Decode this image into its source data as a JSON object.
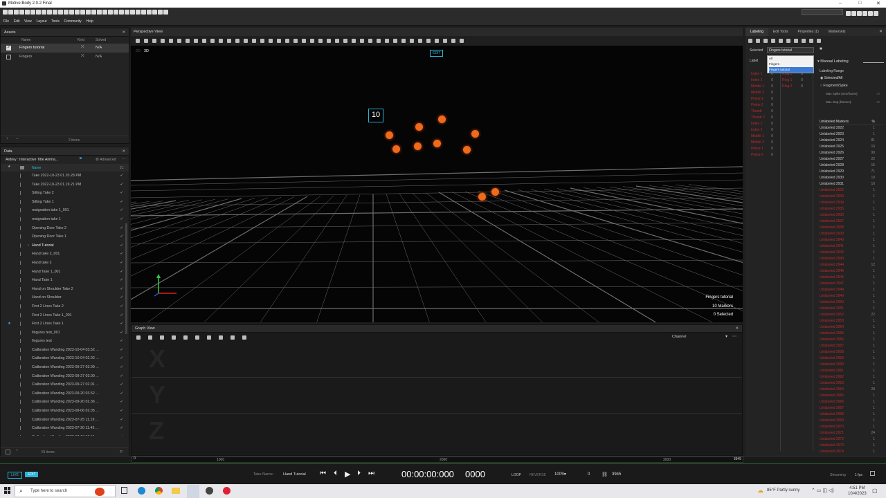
{
  "window": {
    "title": "Motive:Body 2.0.2 Final",
    "controls": [
      "–",
      "□",
      "✕"
    ]
  },
  "menu": [
    "File",
    "Edit",
    "View",
    "Layout",
    "Tools",
    "Community",
    "Help"
  ],
  "assets": {
    "title": "Assets",
    "cols": {
      "name": "Name",
      "kind": "Kind",
      "solved": "Solved"
    },
    "rows": [
      {
        "name": "Fingers tutorial",
        "solved": "N/A",
        "checked": true
      },
      {
        "name": "Fingers",
        "solved": "N/A",
        "checked": false
      }
    ],
    "footer": "2 items"
  },
  "data": {
    "title": "Data",
    "project": "Ardrey : Interactive Title Anima...",
    "advanced": "Advanced",
    "col_name": "Name",
    "count_col": "21",
    "takes": [
      "Take 2022-10-23 01.20.28 PM",
      "Take 2022-10-23 01.19.21 PM",
      "Sitting Take 2",
      "Sitting Take 1",
      "resignation take 1_001",
      "resignation take 1",
      "Opening Door Take 2",
      "Opening Door Take 1",
      "Hand Tutorial",
      "Hand take 2_001",
      "Hand take 2",
      "Hand Take 1_001",
      "Hand Take 1",
      "Hand on Shoulder Take 2",
      "Hand on Shoulder",
      "First 2 Lines Take 2",
      "First 2 Lines Take 1_001",
      "First 2 Lines Take 1",
      "fingures test_001",
      "fingures test",
      "Calibration Wanding 2023-10-04 03.52 ...",
      "Calibration Wanding 2023-10-04 02.02 ...",
      "Calibration Wanding 2023-09-27 03.09 ...",
      "Calibration Wanding 2023-09-27 03.00 ...",
      "Calibration Wanding 2023-09-27 02.01 ...",
      "Calibration Wanding 2023-09-20 03.52 ...",
      "Calibration Wanding 2023-09-20 02.36 ...",
      "Calibration Wanding 2023-09-06 02.05 ...",
      "Calibration Wanding 2023-07-25 11.19 ...",
      "Calibration Wanding 2023-07-20 11.45 ...",
      "Calibration Wanding 2023-07-13 08.51 ..."
    ],
    "footer": "81 items"
  },
  "viewport": {
    "title": "Perspective View",
    "mode": "3D",
    "edit_badge": "EDIT",
    "asset_tag": "10",
    "info": {
      "asset": "Fingers tutorial",
      "markers": "10 Markers",
      "selected": "0 Selected"
    }
  },
  "graph": {
    "title": "Graph View",
    "channel": "Channel",
    "labels": [
      "X",
      "Y",
      "Z"
    ]
  },
  "labeling": {
    "tabs": [
      "Labeling",
      "Edit Tools",
      "Properties (1)",
      "Markersets"
    ],
    "selected_label": "Selected",
    "selected_value": "Fingers tutorial",
    "dropdown": [
      "All",
      "Fingers",
      "Fingers tutorial"
    ],
    "label_col": "Label",
    "labels_left": [
      "Index 1",
      "Index 2",
      "Middle 1",
      "Middle 2",
      "Pinkie 1",
      "Pinkie 2",
      "Thumb",
      "Thumb 2",
      "Index 1",
      "Index 2",
      "Middle 1",
      "Middle 2",
      "Pinkie 1",
      "Pinkie 2"
    ],
    "labels_right": [
      "Ring 2",
      "Ring 1",
      "Ring 2"
    ],
    "manual_labeling": "Manual Labeling",
    "labeling_range": "Labeling Range",
    "opt_all": "Selected/All",
    "opt_frag": "Fragment/Spike",
    "max_spike": "Max Spike (mm/frame):",
    "max_spike_val": "70",
    "max_gap": "Max Gap (frames):",
    "max_gap_val": "10",
    "unlabeled_title": "Unlabeled Markers",
    "pct": "%",
    "unlabeled_white": [
      [
        "Unlabeled 2922",
        "1"
      ],
      [
        "Unlabeled 2923",
        "1"
      ],
      [
        "Unlabeled 2924",
        "81"
      ],
      [
        "Unlabeled 2925",
        "16"
      ],
      [
        "Unlabeled 2926",
        "99"
      ],
      [
        "Unlabeled 2927",
        "22"
      ],
      [
        "Unlabeled 2928",
        "15"
      ],
      [
        "Unlabeled 2929",
        "71"
      ],
      [
        "Unlabeled 2930",
        "10"
      ],
      [
        "Unlabeled 2931",
        "16"
      ]
    ],
    "unlabeled_red": [
      [
        "Unlabeled 2932",
        "1"
      ],
      [
        "Unlabeled 2933",
        "1"
      ],
      [
        "Unlabeled 2934",
        "1"
      ],
      [
        "Unlabeled 2935",
        "1"
      ],
      [
        "Unlabeled 2936",
        "1"
      ],
      [
        "Unlabeled 2937",
        "1"
      ],
      [
        "Unlabeled 2938",
        "1"
      ],
      [
        "Unlabeled 2939",
        "1"
      ],
      [
        "Unlabeled 2940",
        "1"
      ],
      [
        "Unlabeled 2941",
        "1"
      ],
      [
        "Unlabeled 2942",
        "1"
      ],
      [
        "Unlabeled 2943",
        "1"
      ],
      [
        "Unlabeled 2944",
        "12"
      ],
      [
        "Unlabeled 2945",
        "1"
      ],
      [
        "Unlabeled 2946",
        "1"
      ],
      [
        "Unlabeled 2947",
        "1"
      ],
      [
        "Unlabeled 2948",
        "1"
      ],
      [
        "Unlabeled 2949",
        "1"
      ],
      [
        "Unlabeled 2950",
        "1"
      ],
      [
        "Unlabeled 2951",
        "1"
      ],
      [
        "Unlabeled 2952",
        "22"
      ],
      [
        "Unlabeled 2953",
        "1"
      ],
      [
        "Unlabeled 2954",
        "1"
      ],
      [
        "Unlabeled 2955",
        "1"
      ],
      [
        "Unlabeled 2956",
        "1"
      ],
      [
        "Unlabeled 2957",
        "1"
      ],
      [
        "Unlabeled 2958",
        "1"
      ],
      [
        "Unlabeled 2959",
        "1"
      ],
      [
        "Unlabeled 2960",
        "1"
      ],
      [
        "Unlabeled 2961",
        "1"
      ],
      [
        "Unlabeled 2962",
        "1"
      ],
      [
        "Unlabeled 2963",
        "1"
      ],
      [
        "Unlabeled 2964",
        "28"
      ],
      [
        "Unlabeled 2965",
        "1"
      ],
      [
        "Unlabeled 2966",
        "1"
      ],
      [
        "Unlabeled 2967",
        "1"
      ],
      [
        "Unlabeled 2968",
        "1"
      ],
      [
        "Unlabeled 2969",
        "1"
      ],
      [
        "Unlabeled 2970",
        "1"
      ],
      [
        "Unlabeled 2971",
        "24"
      ],
      [
        "Unlabeled 2972",
        "1"
      ],
      [
        "Unlabeled 2973",
        "1"
      ],
      [
        "Unlabeled 2974",
        "1"
      ],
      [
        "Unlabeled 2975",
        "1"
      ],
      [
        "Unlabeled 2976",
        "1"
      ],
      [
        "Unlabeled 2977",
        "1"
      ],
      [
        "Unlabeled 2978",
        "1"
      ],
      [
        "Unlabeled 2979",
        "1"
      ]
    ]
  },
  "timeline": {
    "start": "0",
    "m1": "1000",
    "m2": "2000",
    "m3": "3000",
    "end": "3945",
    "live": "LIVE",
    "edit": "EDIT",
    "take_label": "Take Name:",
    "take_name": "Hand Tutorial",
    "timecode": "00:00:00:000",
    "frame": "0000",
    "loop": "LOOP",
    "reverse": "REVERSE",
    "speed": "100%",
    "cur": "0",
    "total": "3945",
    "streaming": "Streaming",
    "fps": "1 fps"
  },
  "taskbar": {
    "search": "Type here to search",
    "weather": "85°F Partly sunny",
    "time": "4:51 PM",
    "date": "10/4/2023"
  },
  "colors": {
    "accent": "#2ab3d8",
    "marker": "#f06a1a",
    "red": "#c2282e"
  }
}
